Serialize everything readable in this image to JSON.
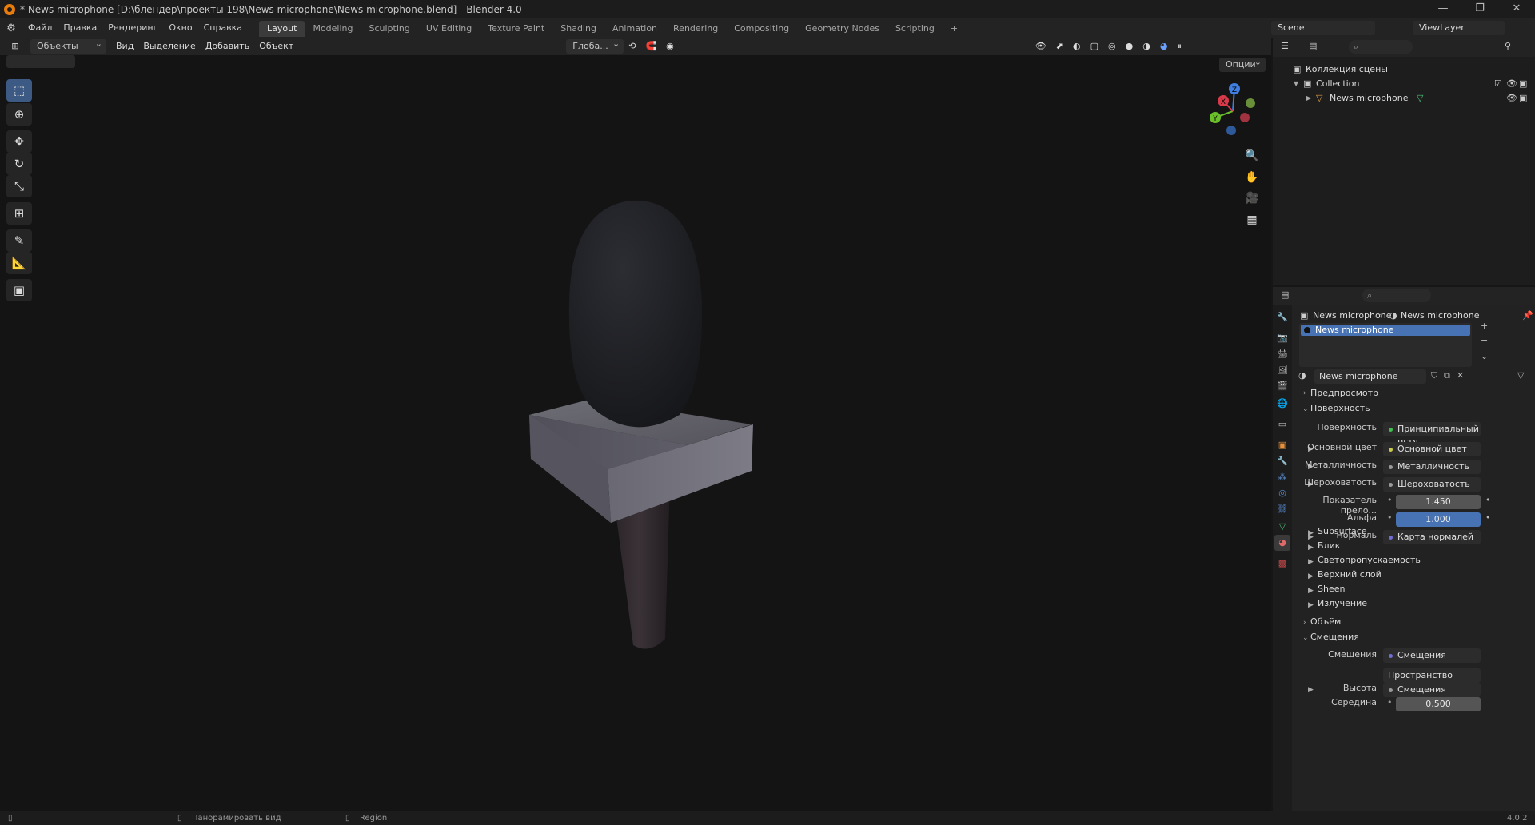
{
  "title_bar": {
    "text": "* News microphone [D:\\блендер\\проекты 198\\News microphone\\News microphone.blend] - Blender 4.0",
    "minimize": "—",
    "maximize": "❐",
    "close": "✕"
  },
  "menu": [
    "Файл",
    "Правка",
    "Рендеринг",
    "Окно",
    "Справка"
  ],
  "workspaces": [
    "Layout",
    "Modeling",
    "Sculpting",
    "UV Editing",
    "Texture Paint",
    "Shading",
    "Animation",
    "Rendering",
    "Compositing",
    "Geometry Nodes",
    "Scripting"
  ],
  "workspace_add": "+",
  "active_workspace": "Layout",
  "scene": "Scene",
  "view_layer": "ViewLayer",
  "viewport_header": {
    "mode": "Объекты",
    "view": "Вид",
    "select": "Выделение",
    "add": "Добавить",
    "object": "Объект",
    "orientation": "Глоба...",
    "options": "Опции"
  },
  "gizmo": {
    "x": "X",
    "y": "Y",
    "z": "Z"
  },
  "outliner": {
    "root": "Коллекция сцены",
    "collection": "Collection",
    "object": "News microphone"
  },
  "properties": {
    "breadcrumb_object": "News microphone",
    "breadcrumb_material": "News microphone",
    "slot": "News microphone",
    "material_name": "News microphone",
    "sections": {
      "preview": "Предпросмотр",
      "surface": "Поверхность",
      "volume": "Объём",
      "displacement": "Смещения"
    },
    "rows": [
      {
        "label": "Поверхность",
        "value": "Принципиальный BSDF",
        "dot": "#3fbf4f"
      },
      {
        "label": "Основной цвет",
        "value": "Основной цвет",
        "dot": "#c9c94a"
      },
      {
        "label": "Металличность",
        "value": "Металличность",
        "dot": "#9a9a9a"
      },
      {
        "label": "Шероховатость",
        "value": "Шероховатость",
        "dot": "#9a9a9a"
      },
      {
        "label": "Показатель прело...",
        "value": "1.450",
        "dot": "#9a9a9a"
      },
      {
        "label": "Альфа",
        "value": "1.000",
        "dot": "#9a9a9a"
      },
      {
        "label": "Нормаль",
        "value": "Карта нормалей",
        "dot": "#6f6fd6"
      }
    ],
    "subsections": [
      "Subsurface",
      "Блик",
      "Светопропускаемость",
      "Верхний слой",
      "Sheen",
      "Излучение"
    ],
    "displacement_rows": {
      "label": "Смещения",
      "value": "Смещения",
      "space": "Пространство объекта",
      "height_label": "Высота",
      "height_value": "Смещения",
      "mid_label": "Середина",
      "mid_value": "0.500"
    }
  },
  "status_bar": {
    "pan": "Панорамировать вид",
    "region": "Region",
    "version": "4.0.2"
  }
}
